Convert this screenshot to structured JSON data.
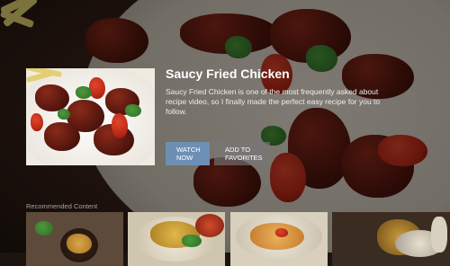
{
  "featured": {
    "title": "Saucy Fried Chicken",
    "description": "Saucy Fried Chicken is one of the most frequently asked about recipe video, so I finally made the perfect easy recipe for you to follow.",
    "watch_label": "WATCH NOW",
    "favorites_label": "ADD TO FAVORITES"
  },
  "recommended": {
    "label": "Recommended Content",
    "items": [
      "",
      "",
      "",
      "",
      ""
    ]
  },
  "colors": {
    "watch_button": "#6e8fb5",
    "favorites_button": "#7a7a7a",
    "title_text": "#ffffff",
    "section_label": "#a7a29d"
  }
}
